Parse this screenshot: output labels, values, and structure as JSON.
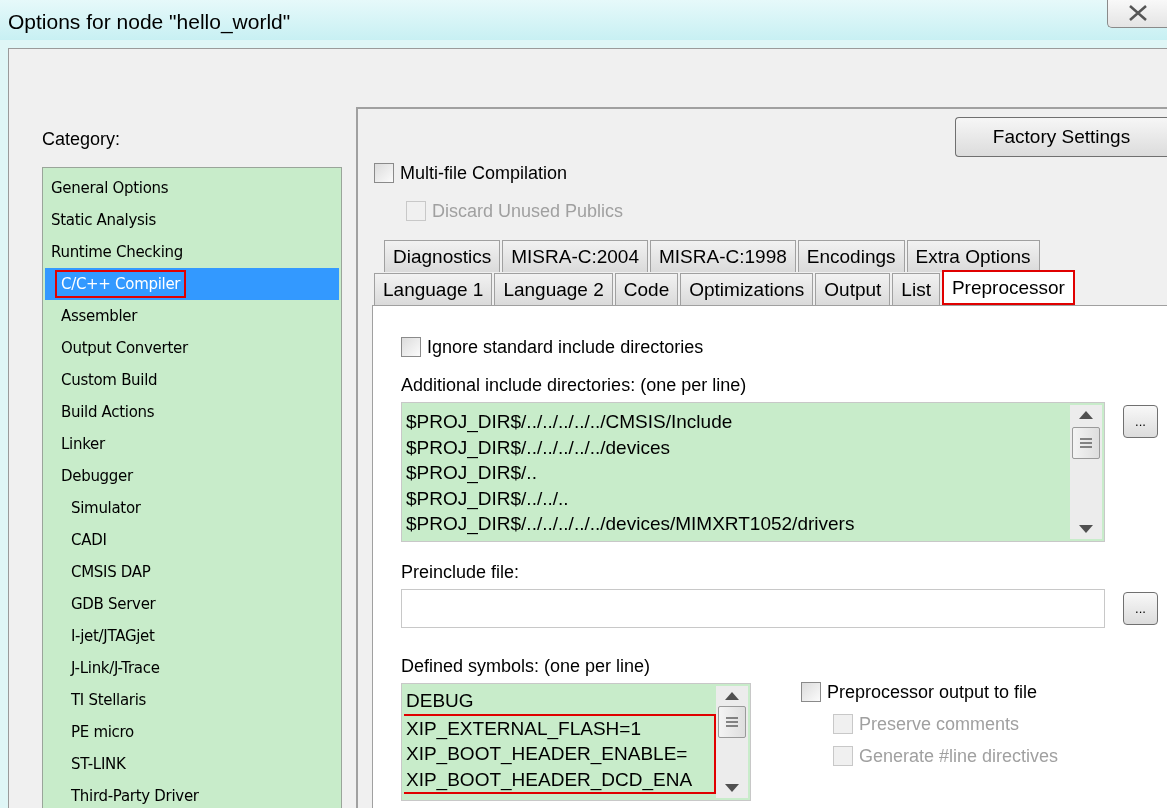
{
  "window": {
    "title": "Options for node \"hello_world\""
  },
  "category": {
    "label": "Category:",
    "items": [
      {
        "label": "General Options",
        "kind": "plain",
        "selected": false,
        "highlighted": false
      },
      {
        "label": "Static Analysis",
        "kind": "plain",
        "selected": false,
        "highlighted": false
      },
      {
        "label": "Runtime Checking",
        "kind": "plain",
        "selected": false,
        "highlighted": false
      },
      {
        "label": "C/C++ Compiler",
        "kind": "tool",
        "selected": true,
        "highlighted": true
      },
      {
        "label": "Assembler",
        "kind": "tool",
        "selected": false,
        "highlighted": false
      },
      {
        "label": "Output Converter",
        "kind": "tool",
        "selected": false,
        "highlighted": false
      },
      {
        "label": "Custom Build",
        "kind": "tool",
        "selected": false,
        "highlighted": false
      },
      {
        "label": "Build Actions",
        "kind": "tool",
        "selected": false,
        "highlighted": false
      },
      {
        "label": "Linker",
        "kind": "tool",
        "selected": false,
        "highlighted": false
      },
      {
        "label": "Debugger",
        "kind": "tool",
        "selected": false,
        "highlighted": false,
        "children": [
          {
            "label": "Simulator",
            "kind": "tool",
            "selected": false,
            "highlighted": false
          },
          {
            "label": "CADI",
            "kind": "tool",
            "selected": false,
            "highlighted": false
          },
          {
            "label": "CMSIS DAP",
            "kind": "tool",
            "selected": false,
            "highlighted": false
          },
          {
            "label": "GDB Server",
            "kind": "tool",
            "selected": false,
            "highlighted": false
          },
          {
            "label": "I-jet/JTAGjet",
            "kind": "tool",
            "selected": false,
            "highlighted": false
          },
          {
            "label": "J-Link/J-Trace",
            "kind": "tool",
            "selected": false,
            "highlighted": false
          },
          {
            "label": "TI Stellaris",
            "kind": "tool",
            "selected": false,
            "highlighted": false
          },
          {
            "label": "PE micro",
            "kind": "tool",
            "selected": false,
            "highlighted": false
          },
          {
            "label": "ST-LINK",
            "kind": "tool",
            "selected": false,
            "highlighted": false
          },
          {
            "label": "Third-Party Driver",
            "kind": "tool",
            "selected": false,
            "highlighted": false
          }
        ]
      }
    ]
  },
  "factory_settings_button": "Factory Settings",
  "multi_file": {
    "label": "Multi-file Compilation",
    "checked": false,
    "disabled": false
  },
  "discard_unused": {
    "label": "Discard Unused Publics",
    "checked": false,
    "disabled": true
  },
  "tab_rows": [
    [
      {
        "label": "Diagnostics",
        "selected": false,
        "highlighted": false
      },
      {
        "label": "MISRA-C:2004",
        "selected": false,
        "highlighted": false
      },
      {
        "label": "MISRA-C:1998",
        "selected": false,
        "highlighted": false
      },
      {
        "label": "Encodings",
        "selected": false,
        "highlighted": false
      },
      {
        "label": "Extra Options",
        "selected": false,
        "highlighted": false
      }
    ],
    [
      {
        "label": "Language 1",
        "selected": false,
        "highlighted": false
      },
      {
        "label": "Language 2",
        "selected": false,
        "highlighted": false
      },
      {
        "label": "Code",
        "selected": false,
        "highlighted": false
      },
      {
        "label": "Optimizations",
        "selected": false,
        "highlighted": false
      },
      {
        "label": "Output",
        "selected": false,
        "highlighted": false
      },
      {
        "label": "List",
        "selected": false,
        "highlighted": false
      },
      {
        "label": "Preprocessor",
        "selected": true,
        "highlighted": true
      }
    ]
  ],
  "ignore_std": {
    "label": "Ignore standard include directories",
    "checked": false,
    "disabled": false
  },
  "include_dirs": {
    "label": "Additional include directories: (one per line)",
    "lines": [
      "$PROJ_DIR$/../../../../../CMSIS/Include",
      "$PROJ_DIR$/../../../../../devices",
      "$PROJ_DIR$/..",
      "$PROJ_DIR$/../../..",
      "$PROJ_DIR$/../../../../../devices/MIMXRT1052/drivers"
    ],
    "browse": "..."
  },
  "preinclude": {
    "label": "Preinclude file:",
    "browse": "..."
  },
  "defined_symbols": {
    "label": "Defined symbols: (one per line)",
    "lines": [
      "DEBUG"
    ],
    "highlighted_lines": [
      "XIP_EXTERNAL_FLASH=1",
      "XIP_BOOT_HEADER_ENABLE=",
      "XIP_BOOT_HEADER_DCD_ENA"
    ]
  },
  "preprocessor_output": {
    "label": "Preprocessor output to file",
    "checked": false,
    "disabled": false
  },
  "preserve_comments": {
    "label": "Preserve comments",
    "checked": false,
    "disabled": true
  },
  "line_directives": {
    "label": "Generate #line directives",
    "checked": false,
    "disabled": true
  }
}
